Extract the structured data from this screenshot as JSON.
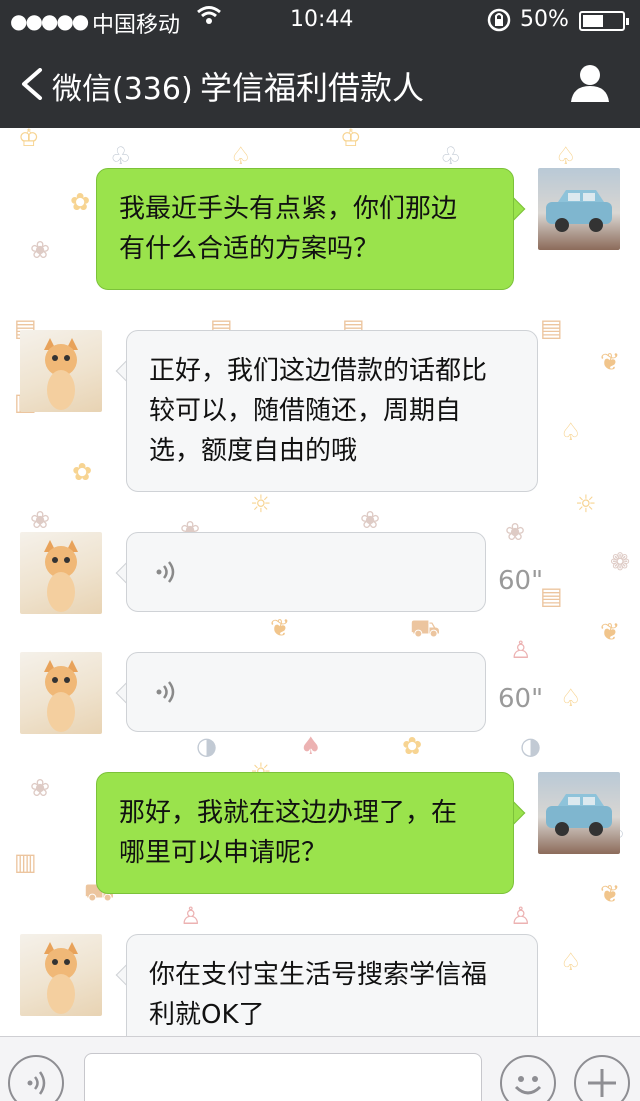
{
  "status_bar": {
    "signal": "●●●●●",
    "carrier": "中国移动",
    "time": "10:44",
    "battery_pct": "50%"
  },
  "nav_bar": {
    "back_label": "微信(336)",
    "title": "学信福利借款人"
  },
  "messages": [
    {
      "type": "text",
      "direction": "outgoing",
      "text_lines": [
        "我最近手头有点紧，你们那边",
        "有什么合适的方案吗？"
      ]
    },
    {
      "type": "text",
      "direction": "incoming",
      "text_lines": [
        "正好，我们这边借款的话都比",
        "较可以，随借随还，周期自",
        "选，额度自由的哦"
      ]
    },
    {
      "type": "voice",
      "direction": "incoming",
      "duration": "60\""
    },
    {
      "type": "voice",
      "direction": "incoming",
      "duration": "60\""
    },
    {
      "type": "text",
      "direction": "outgoing",
      "text_lines": [
        "那好，我就在这边办理了，在",
        "哪里可以申请呢？"
      ]
    },
    {
      "type": "text",
      "direction": "incoming",
      "text_lines": [
        "你在支付宝生活号搜索学信福",
        "利就OK了"
      ]
    }
  ],
  "colors": {
    "nav_bg": "#2f3134",
    "outgoing_bubble": "#9ae34c",
    "incoming_bubble": "#f6f7f8",
    "duration_text": "#9a9a9a"
  },
  "icons": {
    "back": "chevron-left-icon",
    "profile": "person-icon",
    "voice": "voice-wave-icon",
    "input_voice": "voice-input-icon",
    "emoji": "smiley-icon",
    "add": "plus-icon"
  }
}
